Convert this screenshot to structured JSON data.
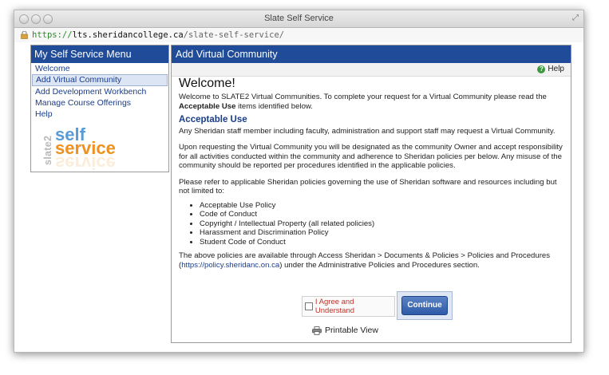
{
  "window": {
    "title": "Slate Self Service"
  },
  "url": {
    "scheme": "https://",
    "host": "lts.sheridancollege.ca",
    "path": "/slate-self-service/"
  },
  "sidebar": {
    "title": "My Self Service Menu",
    "items": [
      {
        "label": "Welcome"
      },
      {
        "label": "Add Virtual Community",
        "active": true
      },
      {
        "label": "Add Development Workbench"
      },
      {
        "label": "Manage Course Offerings"
      },
      {
        "label": "Help"
      }
    ]
  },
  "logo": {
    "slate": "slate2",
    "self": "self",
    "service": "service"
  },
  "panel": {
    "title": "Add Virtual Community",
    "help_label": "Help",
    "welcome_title": "Welcome!",
    "intro_before": "Welcome to SLATE2 Virtual Communities. To complete your request for a Virtual Community please read the ",
    "intro_bold": "Acceptable Use",
    "intro_after": " items identified below.",
    "section_title": "Acceptable Use",
    "para1": "Any Sheridan staff member including faculty, administration and support staff may request a Virtual Community.",
    "para2": "Upon requesting the Virtual Community you will be designated as the community Owner and accept responsibility for all activities conducted within the community and adherence to Sheridan policies per below. Any misuse of the community should be reported per procedures identified in the applicable policies.",
    "para3": "Please refer to applicable Sheridan policies governing the use of Sheridan software and resources including but not limited to:",
    "policies": [
      "Acceptable Use Policy",
      "Code of Conduct",
      "Copyright / Intellectual Property (all related policies)",
      "Harassment and Discrimination Policy",
      "Student Code of Conduct"
    ],
    "para4_before": "The above policies are available through Access Sheridan > Documents & Policies > Policies and Procedures (",
    "para4_link": "https://policy.sheridanc.on.ca",
    "para4_after": ") under the Administrative Policies and Procedures section.",
    "agree_label": "I Agree and Understand",
    "continue_label": "Continue",
    "printable_label": "Printable View"
  },
  "colors": {
    "header_blue": "#1f4b99",
    "link_blue": "#1a3d8a",
    "agree_red": "#c0322a"
  }
}
